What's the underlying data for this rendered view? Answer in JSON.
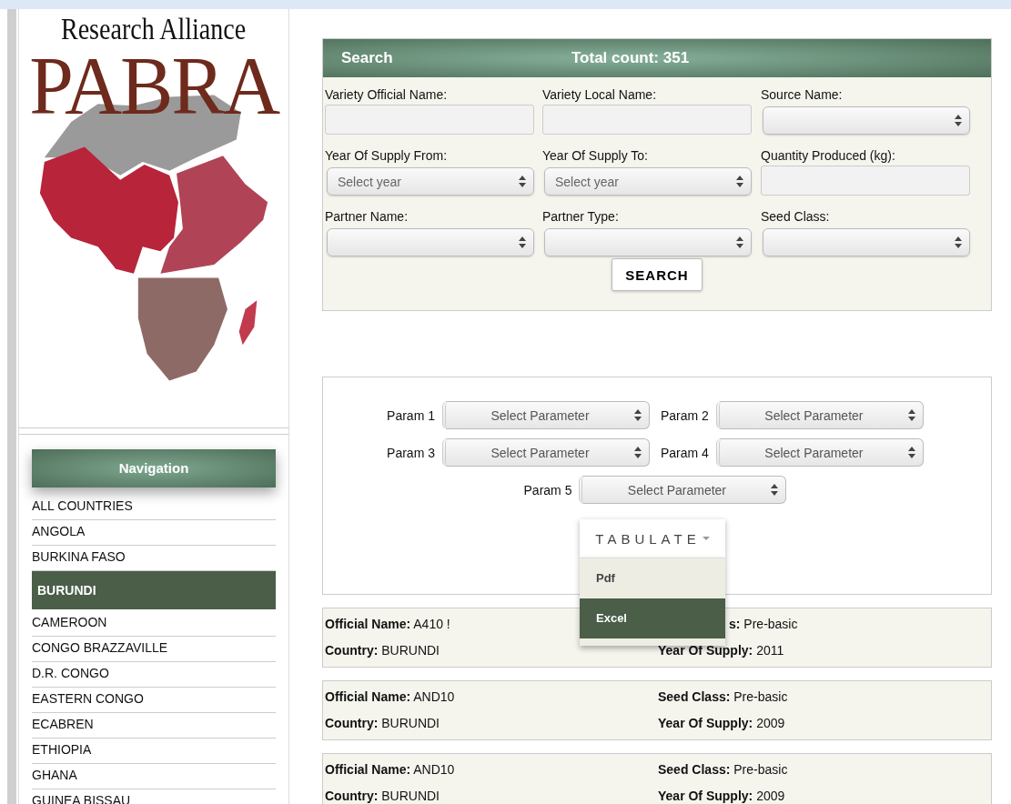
{
  "logo": {
    "tagline": "Research Alliance",
    "name": "PABRA"
  },
  "navigation": {
    "title": "Navigation",
    "items": [
      {
        "label": "ALL COUNTRIES",
        "selected": false
      },
      {
        "label": "ANGOLA",
        "selected": false
      },
      {
        "label": "BURKINA FASO",
        "selected": false
      },
      {
        "label": "BURUNDI",
        "selected": true
      },
      {
        "label": "CAMEROON",
        "selected": false
      },
      {
        "label": "CONGO BRAZZAVILLE",
        "selected": false
      },
      {
        "label": "D.R. CONGO",
        "selected": false
      },
      {
        "label": "EASTERN CONGO",
        "selected": false
      },
      {
        "label": "ECABREN",
        "selected": false
      },
      {
        "label": "ETHIOPIA",
        "selected": false
      },
      {
        "label": "GHANA",
        "selected": false
      },
      {
        "label": "GUINEA BISSAU",
        "selected": false
      }
    ]
  },
  "search": {
    "title": "Search",
    "total": "Total count: 351",
    "fields": [
      {
        "label": "Variety Official Name:",
        "kind": "text"
      },
      {
        "label": "Variety Local Name:",
        "kind": "text"
      },
      {
        "label": "Source Name:",
        "kind": "select"
      },
      {
        "label": "Year Of Supply From:",
        "kind": "select",
        "placeholder": "Select year"
      },
      {
        "label": "Year Of Supply To:",
        "kind": "select",
        "placeholder": "Select year"
      },
      {
        "label": "Quantity Produced (kg):",
        "kind": "text"
      },
      {
        "label": "Partner Name:",
        "kind": "select"
      },
      {
        "label": "Partner Type:",
        "kind": "select"
      },
      {
        "label": "Seed Class:",
        "kind": "select"
      }
    ],
    "button": "SEARCH"
  },
  "tabulate": {
    "params": [
      {
        "label": "Param 1",
        "placeholder": "Select Parameter"
      },
      {
        "label": "Param 2",
        "placeholder": "Select Parameter"
      },
      {
        "label": "Param 3",
        "placeholder": "Select Parameter"
      },
      {
        "label": "Param 4",
        "placeholder": "Select Parameter"
      },
      {
        "label": "Param 5",
        "placeholder": "Select Parameter"
      }
    ],
    "button": "TABULATE",
    "expanded": true,
    "menu": [
      {
        "label": "Pdf",
        "selected": false
      },
      {
        "label": "Excel",
        "selected": true
      }
    ]
  },
  "records": [
    {
      "fields": [
        {
          "label": "Official Name:",
          "value": "A410 !"
        },
        {
          "label": "s:",
          "value": "Pre-basic"
        },
        {
          "label": "Country:",
          "value": "BURUNDI"
        },
        {
          "label": "Year Of Supply:",
          "value": "2011"
        }
      ]
    },
    {
      "fields": [
        {
          "label": "Official Name:",
          "value": "AND10"
        },
        {
          "label": "Seed Class:",
          "value": "Pre-basic"
        },
        {
          "label": "Country:",
          "value": "BURUNDI"
        },
        {
          "label": "Year Of Supply:",
          "value": "2009"
        }
      ]
    },
    {
      "fields": [
        {
          "label": "Official Name:",
          "value": "AND10"
        },
        {
          "label": "Seed Class:",
          "value": "Pre-basic"
        },
        {
          "label": "Country:",
          "value": "BURUNDI"
        },
        {
          "label": "Year Of Supply:",
          "value": "2009"
        }
      ]
    }
  ]
}
